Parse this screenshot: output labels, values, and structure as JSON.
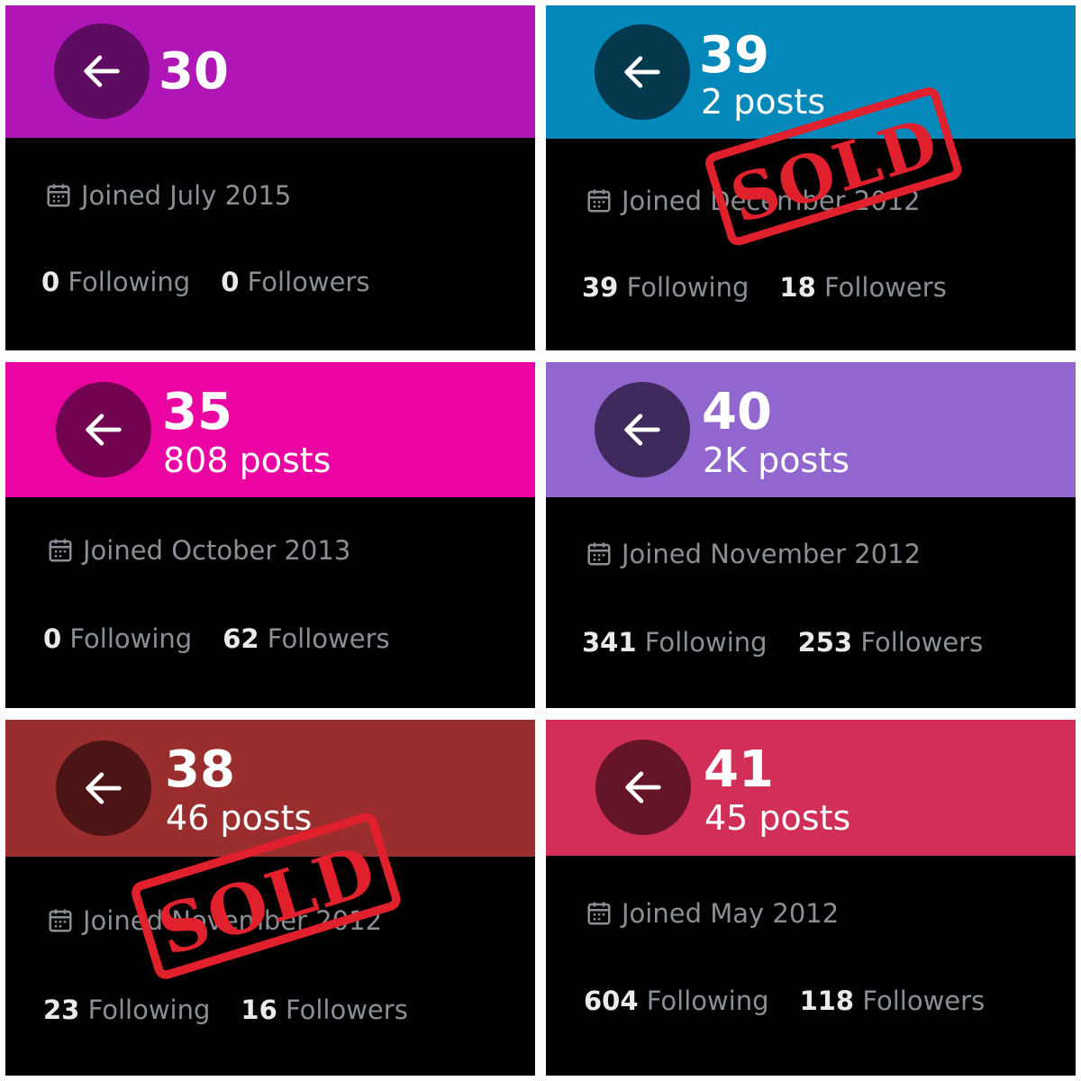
{
  "cards": [
    {
      "banner_color": "#b015b5",
      "button_color": "#5e0c61",
      "count": "30",
      "posts": "",
      "joined": "Joined July 2015",
      "following_count": "0",
      "following_label": "Following",
      "followers_count": "0",
      "followers_label": "Followers",
      "sold": false
    },
    {
      "banner_color": "#0487b9",
      "button_color": "#03384d",
      "count": "39",
      "posts": "2 posts",
      "joined": "Joined December 2012",
      "following_count": "39",
      "following_label": "Following",
      "followers_count": "18",
      "followers_label": "Followers",
      "sold": true,
      "sold_text": "SOLD"
    },
    {
      "banner_color": "#ec04a3",
      "button_color": "#720350",
      "count": "35",
      "posts": "808 posts",
      "joined": "Joined October 2013",
      "following_count": "0",
      "following_label": "Following",
      "followers_count": "62",
      "followers_label": "Followers",
      "sold": false
    },
    {
      "banner_color": "#9166cf",
      "button_color": "#3e2a5c",
      "count": "40",
      "posts": "2K posts",
      "joined": "Joined November 2012",
      "following_count": "341",
      "following_label": "Following",
      "followers_count": "253",
      "followers_label": "Followers",
      "sold": false
    },
    {
      "banner_color": "#9a2d2e",
      "button_color": "#4d1415",
      "count": "38",
      "posts": "46 posts",
      "joined": "Joined November 2012",
      "following_count": "23",
      "following_label": "Following",
      "followers_count": "16",
      "followers_label": "Followers",
      "sold": true,
      "sold_text": "SOLD"
    },
    {
      "banner_color": "#d22f58",
      "button_color": "#661428",
      "count": "41",
      "posts": "45 posts",
      "joined": "Joined May 2012",
      "following_count": "604",
      "following_label": "Following",
      "followers_count": "118",
      "followers_label": "Followers",
      "sold": false
    }
  ],
  "stamp_color": "#e0202c",
  "icons": {
    "back": "arrow-left-icon",
    "calendar": "calendar-icon"
  }
}
